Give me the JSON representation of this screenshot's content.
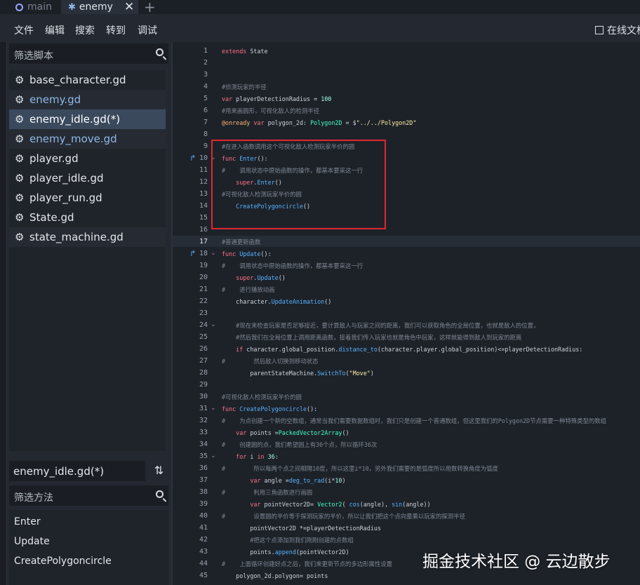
{
  "tabs": [
    {
      "label": "main"
    },
    {
      "label": "enemy"
    }
  ],
  "menu": [
    "文件",
    "编辑",
    "搜索",
    "转到",
    "调试"
  ],
  "online_docs": "在线文档",
  "script_filter_placeholder": "筛选脚本",
  "scripts": [
    {
      "label": "base_character.gd",
      "state": "normal"
    },
    {
      "label": "enemy.gd",
      "state": "modified"
    },
    {
      "label": "enemy_idle.gd(*)",
      "state": "selected"
    },
    {
      "label": "enemy_move.gd",
      "state": "modified"
    },
    {
      "label": "player.gd",
      "state": "normal"
    },
    {
      "label": "player_idle.gd",
      "state": "normal"
    },
    {
      "label": "player_run.gd",
      "state": "normal"
    },
    {
      "label": "State.gd",
      "state": "normal"
    },
    {
      "label": "state_machine.gd",
      "state": "normal"
    }
  ],
  "current_file": "enemy_idle.gd(*)",
  "method_filter_placeholder": "筛选方法",
  "methods": [
    "Enter",
    "Update",
    "CreatePolygoncircle"
  ],
  "current_line": 17,
  "code_lines": [
    {
      "n": 1,
      "text": "extends State"
    },
    {
      "n": 2,
      "text": ""
    },
    {
      "n": 3,
      "text": ""
    },
    {
      "n": 4,
      "text": "#侦测玩家的半径"
    },
    {
      "n": 5,
      "text": "var playerDetectionRadius = 100"
    },
    {
      "n": 6,
      "text": "#用来画圆形，可视化敌人的检测半径"
    },
    {
      "n": 7,
      "text": "@onready var polygon_2d: Polygon2D = $\"../../Polygon2D\""
    },
    {
      "n": 8,
      "text": ""
    },
    {
      "n": 9,
      "text": "#在进入函数调用这个可视化敌人检测玩家半价的圆"
    },
    {
      "n": 10,
      "text": "func Enter():"
    },
    {
      "n": 11,
      "text": "#    调用状态中原始函数的操作，都基本要采这一行"
    },
    {
      "n": 12,
      "text": "    super.Enter()"
    },
    {
      "n": 13,
      "text": "#可视化敌人检测玩家半价的圆"
    },
    {
      "n": 14,
      "text": "    CreatePolygoncircle()"
    },
    {
      "n": 15,
      "text": ""
    },
    {
      "n": 16,
      "text": ""
    },
    {
      "n": 17,
      "text": "#普通更新函数"
    },
    {
      "n": 18,
      "text": "func Update():"
    },
    {
      "n": 19,
      "text": "#    调用状态中原始函数的操作，都基本要采这一行"
    },
    {
      "n": 20,
      "text": "    super.Update()"
    },
    {
      "n": 21,
      "text": "#    进行播放动画"
    },
    {
      "n": 22,
      "text": "    character.UpdateAnimation()"
    },
    {
      "n": 23,
      "text": ""
    },
    {
      "n": 24,
      "text": "    #现在来检查玩家是否足够接近，要计算敌人与玩家之间的距离，我们可以获取角色的全局位置，也就是敌人的位置，"
    },
    {
      "n": 25,
      "text": "    #然后我们在全局位置上调用距离函数，接着我们传入玩家也就是角色中玩家，这样就能得到敌人到玩家的距离"
    },
    {
      "n": 26,
      "text": "    if character.global_position.distance_to(character.player.global_position)<=playerDetectionRadius:"
    },
    {
      "n": 27,
      "text": "#        然后敌人切换到移动状态"
    },
    {
      "n": 28,
      "text": "        parentStateMachine.SwitchTo(\"Move\")"
    },
    {
      "n": 29,
      "text": ""
    },
    {
      "n": 30,
      "text": "#可视化敌人检测玩家半价的圆"
    },
    {
      "n": 31,
      "text": "func CreatePolygoncircle():"
    },
    {
      "n": 32,
      "text": "#    为点创建一个新的空数组，通常当我们需要数据数组时，我们只是创建一个普通数组，但这里我们的Polygon2D节点需要一种特殊类型的数组"
    },
    {
      "n": 33,
      "text": "    var points =PackedVector2Array()"
    },
    {
      "n": 34,
      "text": "#    创建圆的点，我们希望圆上有36个点，所以循环36次"
    },
    {
      "n": 35,
      "text": "    for i in 36:"
    },
    {
      "n": 36,
      "text": "#        所以每两个点之间相隔10度，所以这里i*10，另外我们需要的是弧度所以用数转换角度为弧度"
    },
    {
      "n": 37,
      "text": "        var angle =deg_to_rad(i*10)"
    },
    {
      "n": 38,
      "text": "#        利用三角函数进行画圆"
    },
    {
      "n": 39,
      "text": "        var pointVector2D= Vector2( cos(angle), sin(angle))"
    },
    {
      "n": 40,
      "text": "#        设置圆的半价等于探测玩家的半价，所以让我们把这个点向量乘以玩家的探测半径"
    },
    {
      "n": 41,
      "text": "        pointVector2D *=playerDetectionRadius"
    },
    {
      "n": 42,
      "text": "        #把这个点添加到我们刚刚创建的点数组"
    },
    {
      "n": 43,
      "text": "        points.append(pointVector2D)"
    },
    {
      "n": 44,
      "text": "#    上面循环创建好点之后，我们来更新节点的多边形属性设置"
    },
    {
      "n": 45,
      "text": "    polygon_2d.polygon= points"
    }
  ],
  "watermark": "掘金技术社区 @ 云边散步",
  "colors": {
    "keyword": "#ff7085",
    "type": "#42ffc2",
    "function": "#57b3ff",
    "string": "#ffeda1",
    "comment": "#7f8792",
    "annotation": "#ffb373",
    "highlight_box": "#e22630",
    "selection": "#3a4a5c"
  }
}
